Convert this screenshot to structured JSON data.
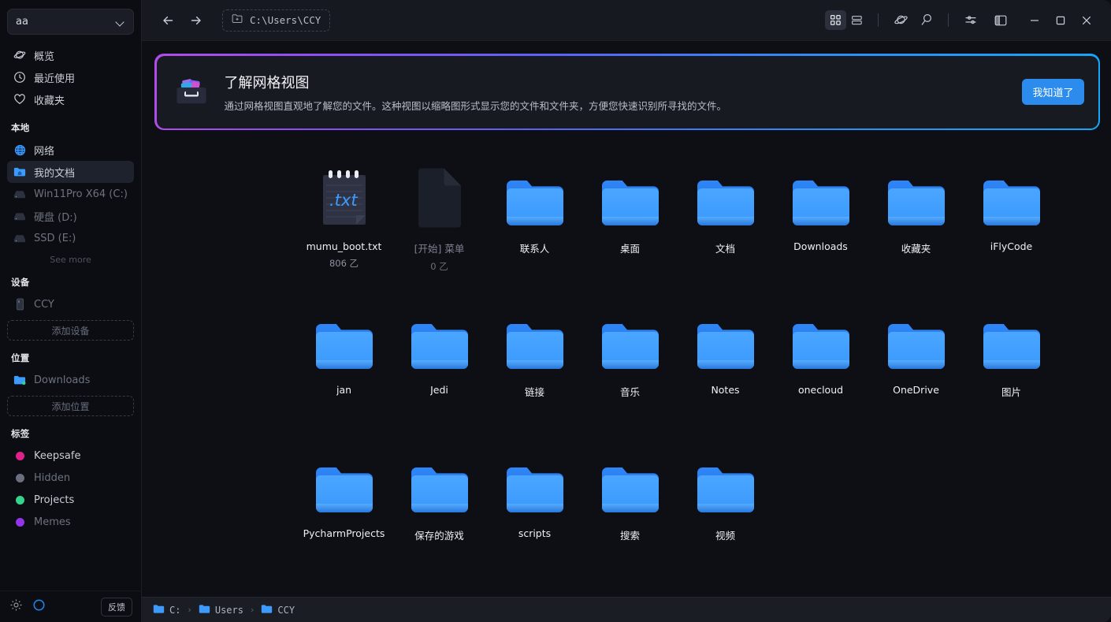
{
  "sidebar": {
    "account": {
      "name": "aa",
      "chevron_icon": "chevron-down-icon"
    },
    "nav": [
      {
        "label": "概览",
        "icon": "planet-icon"
      },
      {
        "label": "最近使用",
        "icon": "clock-icon"
      },
      {
        "label": "收藏夹",
        "icon": "heart-icon"
      }
    ],
    "local": {
      "title": "本地",
      "items": [
        {
          "label": "网络",
          "icon": "globe-icon",
          "dim": false
        },
        {
          "label": "我的文档",
          "icon": "folder-home-icon",
          "dim": false,
          "selected": true
        },
        {
          "label": "Win11Pro X64 (C:)",
          "icon": "drive-icon",
          "dim": true
        },
        {
          "label": "硬盘 (D:)",
          "icon": "drive-icon",
          "dim": true
        },
        {
          "label": "SSD (E:)",
          "icon": "drive-icon",
          "dim": true
        }
      ],
      "see_more": "See more"
    },
    "devices": {
      "title": "设备",
      "items": [
        {
          "label": "CCY",
          "icon": "phone-icon"
        }
      ],
      "add_label": "添加设备"
    },
    "places": {
      "title": "位置",
      "items": [
        {
          "label": "Downloads",
          "icon": "folder-sync-icon"
        }
      ],
      "add_label": "添加位置"
    },
    "tags": {
      "title": "标签",
      "items": [
        {
          "label": "Keepsafe",
          "color": "#e0218a"
        },
        {
          "label": "Hidden",
          "color": "#6b6f7d"
        },
        {
          "label": "Projects",
          "color": "#35d48c"
        },
        {
          "label": "Memes",
          "color": "#9333ea"
        }
      ]
    },
    "bottom": {
      "settings_icon": "gear-icon",
      "status_icon": "circle-progress-icon",
      "feedback_label": "反馈"
    }
  },
  "toolbar": {
    "back_icon": "arrow-left-icon",
    "forward_icon": "arrow-right-icon",
    "path": "C:\\Users\\CCY",
    "path_icon": "folder-plus-icon",
    "view_grid_icon": "grid-view-icon",
    "view_list_icon": "list-view-icon",
    "view_active": "grid",
    "planet_icon": "planet-icon",
    "search_icon": "search-icon",
    "settings_icon": "sliders-icon",
    "panel_icon": "sidebar-panel-icon",
    "minimize_icon": "minimize-icon",
    "maximize_icon": "maximize-icon",
    "close_icon": "close-icon"
  },
  "banner": {
    "icon": "drawer-cards-icon",
    "title": "了解网格视图",
    "description": "通过网格视图直观地了解您的文件。这种视图以缩略图形式显示您的文件和文件夹，方便您快速识别所寻找的文件。",
    "button_label": "我知道了",
    "gradient_from": "#b14de8",
    "gradient_to": "#16a6f7"
  },
  "files": [
    {
      "name": "mumu_boot.txt",
      "size": "806 乙",
      "type": "txt",
      "dim": false
    },
    {
      "name": "[开始] 菜单",
      "size": "0 乙",
      "type": "blank",
      "dim": true
    },
    {
      "name": "联系人",
      "type": "folder",
      "dim": false
    },
    {
      "name": "桌面",
      "type": "folder",
      "dim": false
    },
    {
      "name": "文档",
      "type": "folder",
      "dim": false
    },
    {
      "name": "Downloads",
      "type": "folder",
      "dim": false
    },
    {
      "name": "收藏夹",
      "type": "folder",
      "dim": false
    },
    {
      "name": "iFlyCode",
      "type": "folder",
      "dim": false
    },
    {
      "name": "jan",
      "type": "folder",
      "dim": false
    },
    {
      "name": "Jedi",
      "type": "folder",
      "dim": false
    },
    {
      "name": "链接",
      "type": "folder",
      "dim": false
    },
    {
      "name": "音乐",
      "type": "folder",
      "dim": false
    },
    {
      "name": "Notes",
      "type": "folder",
      "dim": false
    },
    {
      "name": "onecloud",
      "type": "folder",
      "dim": false
    },
    {
      "name": "OneDrive",
      "type": "folder",
      "dim": false
    },
    {
      "name": "图片",
      "type": "folder",
      "dim": false
    },
    {
      "name": "PycharmProjects",
      "type": "folder",
      "dim": false
    },
    {
      "name": "保存的游戏",
      "type": "folder",
      "dim": false
    },
    {
      "name": "scripts",
      "type": "folder",
      "dim": false
    },
    {
      "name": "搜索",
      "type": "folder",
      "dim": false
    },
    {
      "name": "视频",
      "type": "folder",
      "dim": false
    }
  ],
  "breadcrumb": [
    {
      "label": "C:",
      "icon": "folder-icon"
    },
    {
      "label": "Users",
      "icon": "folder-icon"
    },
    {
      "label": "CCY",
      "icon": "folder-icon"
    }
  ],
  "colors": {
    "accent_blue": "#2b8ced",
    "folder_blue": "#3d9bfd",
    "bg": "#0d0f14",
    "sidebar_bg": "#0b0d12",
    "toolbar_bg": "#16191f"
  }
}
